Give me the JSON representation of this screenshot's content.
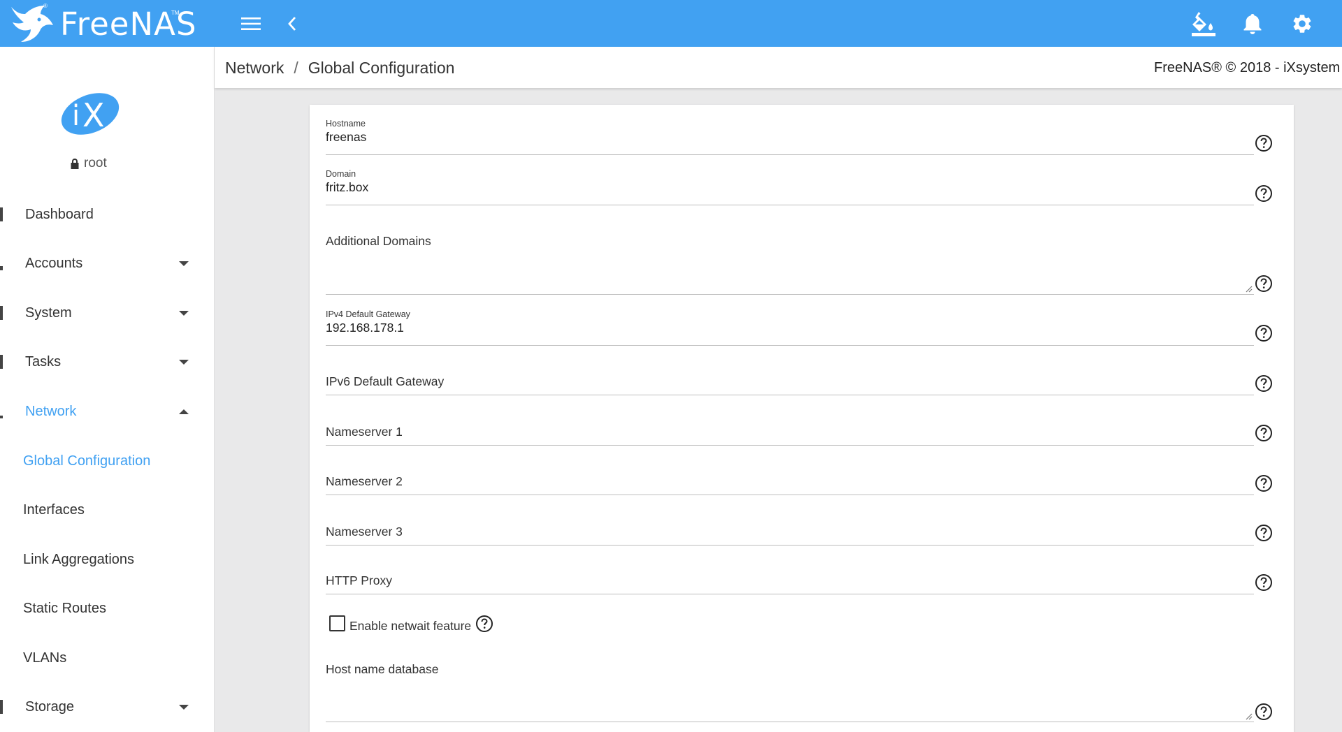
{
  "topbar": {
    "brand": "FreeNAS",
    "accent_color": "#41a1f2",
    "icons": [
      "menu-icon",
      "chevron-left-icon",
      "paint-bucket-icon",
      "bell-icon",
      "gear-icon"
    ]
  },
  "sidebar": {
    "user": "root",
    "items": [
      {
        "label": "Dashboard"
      },
      {
        "label": "Accounts"
      },
      {
        "label": "System"
      },
      {
        "label": "Tasks"
      },
      {
        "label": "Network"
      }
    ],
    "subitems": [
      {
        "label": "Global Configuration"
      },
      {
        "label": "Interfaces"
      },
      {
        "label": "Link Aggregations"
      },
      {
        "label": "Static Routes"
      },
      {
        "label": "VLANs"
      }
    ],
    "storage": {
      "label": "Storage"
    }
  },
  "breadcrumb": {
    "section": "Network",
    "separator": "/",
    "page": "Global Configuration"
  },
  "copyright": "FreeNAS® © 2018 - iXsystem",
  "form": {
    "hostname": {
      "label": "Hostname",
      "value": "freenas"
    },
    "domain": {
      "label": "Domain",
      "value": "fritz.box"
    },
    "additional_domains": {
      "label": "Additional Domains"
    },
    "ipv4_gateway": {
      "label": "IPv4 Default Gateway",
      "value": "192.168.178.1"
    },
    "ipv6_gateway": {
      "label": "IPv6 Default Gateway"
    },
    "nameserver1": {
      "label": "Nameserver 1"
    },
    "nameserver2": {
      "label": "Nameserver 2"
    },
    "nameserver3": {
      "label": "Nameserver 3"
    },
    "http_proxy": {
      "label": "HTTP Proxy"
    },
    "netwait": {
      "label": "Enable netwait feature",
      "checked": false
    },
    "host_db": {
      "label": "Host name database"
    }
  }
}
